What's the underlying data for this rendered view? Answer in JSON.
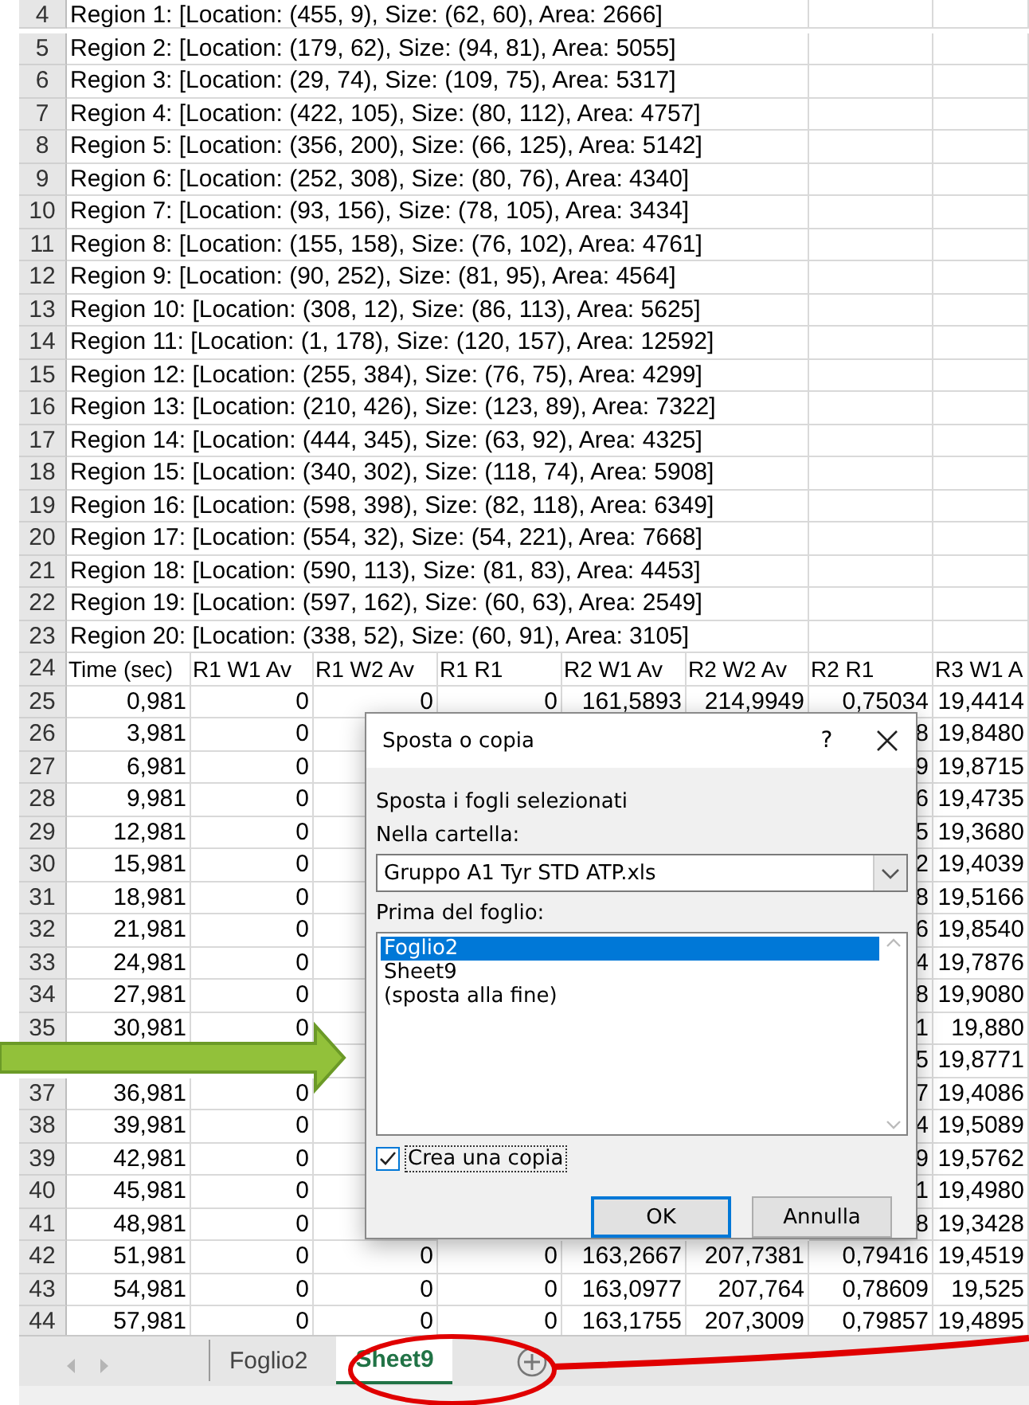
{
  "spreadsheet": {
    "rows": [
      {
        "number": "4",
        "kind": "text",
        "text": "Region 1: [Location: (455, 9), Size: (62, 60), Area: 2666]"
      },
      {
        "number": "5",
        "kind": "text",
        "text": "Region 2: [Location: (179, 62), Size: (94, 81), Area: 5055]"
      },
      {
        "number": "6",
        "kind": "text",
        "text": "Region 3: [Location: (29, 74), Size: (109, 75), Area: 5317]"
      },
      {
        "number": "7",
        "kind": "text",
        "text": "Region 4: [Location: (422, 105), Size: (80, 112), Area: 4757]"
      },
      {
        "number": "8",
        "kind": "text",
        "text": "Region 5: [Location: (356, 200), Size: (66, 125), Area: 5142]"
      },
      {
        "number": "9",
        "kind": "text",
        "text": "Region 6: [Location: (252, 308), Size: (80, 76), Area: 4340]"
      },
      {
        "number": "10",
        "kind": "text",
        "text": "Region 7: [Location: (93, 156), Size: (78, 105), Area: 3434]"
      },
      {
        "number": "11",
        "kind": "text",
        "text": "Region 8: [Location: (155, 158), Size: (76, 102), Area: 4761]"
      },
      {
        "number": "12",
        "kind": "text",
        "text": "Region 9: [Location: (90, 252), Size: (81, 95), Area: 4564]"
      },
      {
        "number": "13",
        "kind": "text",
        "text": "Region 10: [Location: (308, 12), Size: (86, 113), Area: 5625]"
      },
      {
        "number": "14",
        "kind": "text",
        "text": "Region 11: [Location: (1, 178), Size: (120, 157), Area: 12592]"
      },
      {
        "number": "15",
        "kind": "text",
        "text": "Region 12: [Location: (255, 384), Size: (76, 75), Area: 4299]"
      },
      {
        "number": "16",
        "kind": "text",
        "text": "Region 13: [Location: (210, 426), Size: (123, 89), Area: 7322]"
      },
      {
        "number": "17",
        "kind": "text",
        "text": "Region 14: [Location: (444, 345), Size: (63, 92), Area: 4325]"
      },
      {
        "number": "18",
        "kind": "text",
        "text": "Region 15: [Location: (340, 302), Size: (118, 74), Area: 5908]"
      },
      {
        "number": "19",
        "kind": "text",
        "text": "Region 16: [Location: (598, 398), Size: (82, 118), Area: 6349]"
      },
      {
        "number": "20",
        "kind": "text",
        "text": "Region 17: [Location: (554, 32), Size: (54, 221), Area: 7668]"
      },
      {
        "number": "21",
        "kind": "text",
        "text": "Region 18: [Location: (590, 113), Size: (81, 83), Area: 4453]"
      },
      {
        "number": "22",
        "kind": "text",
        "text": "Region 19: [Location: (597, 162), Size: (60, 63), Area: 2549]"
      },
      {
        "number": "23",
        "kind": "text",
        "text": "Region 20: [Location: (338, 52), Size: (60, 91), Area: 3105]"
      },
      {
        "number": "24",
        "kind": "header",
        "cells": [
          "Time (sec)",
          "R1 W1 Av",
          "R1 W2 Av",
          "R1 R1",
          "R2 W1 Av",
          "R2 W2 Av",
          "R2 R1",
          "R3 W1 A"
        ]
      },
      {
        "number": "25",
        "kind": "data",
        "cells": [
          "0,981",
          "0",
          "0",
          "0",
          "161,5893",
          "214,9949",
          "0,75034",
          "19,4414"
        ]
      },
      {
        "number": "26",
        "kind": "data",
        "cells": [
          "3,981",
          "0",
          null,
          null,
          null,
          null,
          "8",
          "19,8480"
        ]
      },
      {
        "number": "27",
        "kind": "data",
        "cells": [
          "6,981",
          "0",
          null,
          null,
          null,
          null,
          "9",
          "19,8715"
        ]
      },
      {
        "number": "28",
        "kind": "data",
        "cells": [
          "9,981",
          "0",
          null,
          null,
          null,
          null,
          "6",
          "19,4735"
        ]
      },
      {
        "number": "29",
        "kind": "data",
        "cells": [
          "12,981",
          "0",
          null,
          null,
          null,
          null,
          "5",
          "19,3680"
        ]
      },
      {
        "number": "30",
        "kind": "data",
        "cells": [
          "15,981",
          "0",
          null,
          null,
          null,
          null,
          "2",
          "19,4039"
        ]
      },
      {
        "number": "31",
        "kind": "data",
        "cells": [
          "18,981",
          "0",
          null,
          null,
          null,
          null,
          "8",
          "19,5166"
        ]
      },
      {
        "number": "32",
        "kind": "data",
        "cells": [
          "21,981",
          "0",
          null,
          null,
          null,
          null,
          "6",
          "19,8540"
        ]
      },
      {
        "number": "33",
        "kind": "data",
        "cells": [
          "24,981",
          "0",
          null,
          null,
          null,
          null,
          "4",
          "19,7876"
        ]
      },
      {
        "number": "34",
        "kind": "data",
        "cells": [
          "27,981",
          "0",
          null,
          null,
          null,
          null,
          "8",
          "19,9080"
        ]
      },
      {
        "number": "35",
        "kind": "data",
        "cells": [
          "30,981",
          "0",
          null,
          null,
          null,
          null,
          "1",
          "19,880"
        ]
      },
      {
        "number": null,
        "kind": "data",
        "cells": [
          null,
          null,
          null,
          null,
          null,
          null,
          "5",
          "19,8771"
        ]
      },
      {
        "number": "37",
        "kind": "data",
        "cells": [
          "36,981",
          "0",
          null,
          null,
          null,
          null,
          "7",
          "19,4086"
        ]
      },
      {
        "number": "38",
        "kind": "data",
        "cells": [
          "39,981",
          "0",
          null,
          null,
          null,
          null,
          "4",
          "19,5089"
        ]
      },
      {
        "number": "39",
        "kind": "data",
        "cells": [
          "42,981",
          "0",
          null,
          null,
          null,
          null,
          "9",
          "19,5762"
        ]
      },
      {
        "number": "40",
        "kind": "data",
        "cells": [
          "45,981",
          "0",
          null,
          null,
          null,
          null,
          "1",
          "19,4980"
        ]
      },
      {
        "number": "41",
        "kind": "data",
        "cells": [
          "48,981",
          "0",
          null,
          null,
          null,
          null,
          "8",
          "19,3428"
        ]
      },
      {
        "number": "42",
        "kind": "data",
        "cells": [
          "51,981",
          "0",
          "0",
          "0",
          "163,2667",
          "207,7381",
          "0,79416",
          "19,4519"
        ]
      },
      {
        "number": "43",
        "kind": "data",
        "cells": [
          "54,981",
          "0",
          "0",
          "0",
          "163,0977",
          "207,764",
          "0,78609",
          "19,525"
        ]
      },
      {
        "number": "44",
        "kind": "data",
        "cells": [
          "57,981",
          "0",
          "0",
          "0",
          "163,1755",
          "207,3009",
          "0,79857",
          "19,4895"
        ]
      }
    ]
  },
  "sheet_tabs": [
    {
      "label": "Foglio2",
      "selected": false
    },
    {
      "label": "Sheet9",
      "selected": true
    }
  ],
  "dialog": {
    "title": "Sposta o copia",
    "help": "?",
    "intro": "Sposta i fogli selezionati",
    "folder_label": "Nella cartella:",
    "folder_value": "Gruppo A1 Tyr STD ATP.xls",
    "before_label": "Prima del foglio:",
    "sheets": [
      {
        "label": "Foglio2",
        "selected": true
      },
      {
        "label": "Sheet9",
        "selected": false
      },
      {
        "label": "(sposta alla fine)",
        "selected": false
      }
    ],
    "copy": {
      "label": "Crea una copia",
      "checked": true
    },
    "buttons": [
      {
        "label": "OK",
        "default": true
      },
      {
        "label": "Annulla",
        "default": false
      }
    ]
  }
}
